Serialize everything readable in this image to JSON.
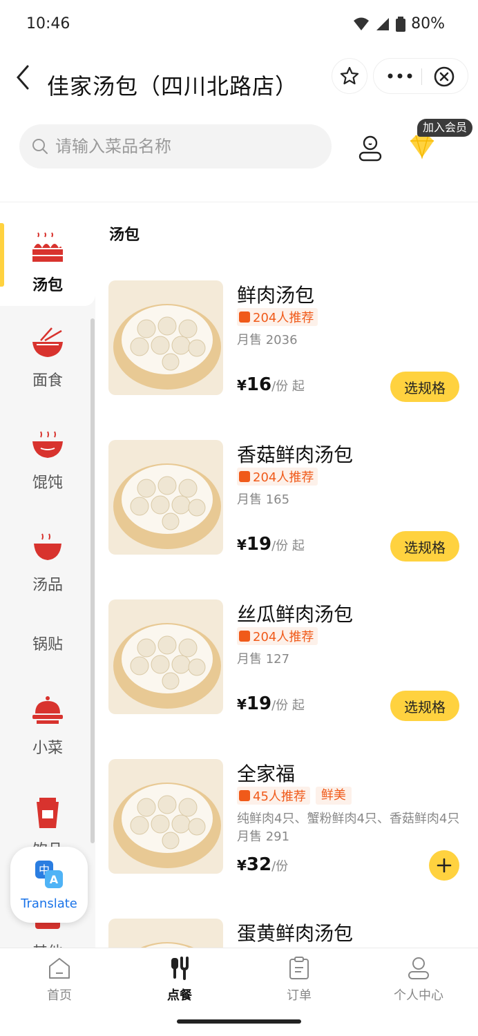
{
  "status_bar": {
    "time": "10:46",
    "battery": "80%"
  },
  "header": {
    "title": "佳家汤包（四川北路店）"
  },
  "search": {
    "placeholder": "请输入菜品名称"
  },
  "member_badge": "加入会员",
  "sidebar": {
    "items": [
      {
        "label": "汤包",
        "icon": "soup-dumpling-icon",
        "active": true
      },
      {
        "label": "面食",
        "icon": "noodle-bowl-icon"
      },
      {
        "label": "馄饨",
        "icon": "wonton-bowl-icon"
      },
      {
        "label": "汤品",
        "icon": "soup-bowl-icon"
      },
      {
        "label": "锅贴",
        "icon": ""
      },
      {
        "label": "小菜",
        "icon": "covered-dish-icon"
      },
      {
        "label": "饮品",
        "icon": "drink-cup-icon"
      },
      {
        "label": "其他",
        "icon": "other-icon"
      }
    ]
  },
  "translate_widget": {
    "label": "Translate"
  },
  "section": {
    "title": "汤包"
  },
  "products": [
    {
      "name": "鲜肉汤包",
      "recommend": "204人推荐",
      "tag": "",
      "desc": "",
      "sold": "月售 2036",
      "currency": "¥",
      "price": "16",
      "unit": "/份 起",
      "action": "选规格"
    },
    {
      "name": "香菇鲜肉汤包",
      "recommend": "204人推荐",
      "tag": "",
      "desc": "",
      "sold": "月售 165",
      "currency": "¥",
      "price": "19",
      "unit": "/份 起",
      "action": "选规格"
    },
    {
      "name": "丝瓜鲜肉汤包",
      "recommend": "204人推荐",
      "tag": "",
      "desc": "",
      "sold": "月售 127",
      "currency": "¥",
      "price": "19",
      "unit": "/份 起",
      "action": "选规格"
    },
    {
      "name": "全家福",
      "recommend": "45人推荐",
      "tag": "鲜美",
      "desc": "纯鲜肉4只、蟹粉鲜肉4只、香菇鲜肉4只",
      "sold": "月售 291",
      "currency": "¥",
      "price": "32",
      "unit": "/份",
      "action": "+"
    },
    {
      "name": "蛋黄鲜肉汤包",
      "recommend": "",
      "tag": "",
      "desc": "",
      "sold": "",
      "currency": "",
      "price": "",
      "unit": "",
      "action": ""
    }
  ],
  "bottom_nav": [
    {
      "label": "首页",
      "icon": "home-icon"
    },
    {
      "label": "点餐",
      "icon": "cutlery-icon",
      "active": true
    },
    {
      "label": "订单",
      "icon": "order-clipboard-icon"
    },
    {
      "label": "个人中心",
      "icon": "profile-icon"
    }
  ],
  "colors": {
    "accent": "#ffd23f",
    "recommend": "#f05a1a",
    "icon_red": "#d8332e"
  }
}
